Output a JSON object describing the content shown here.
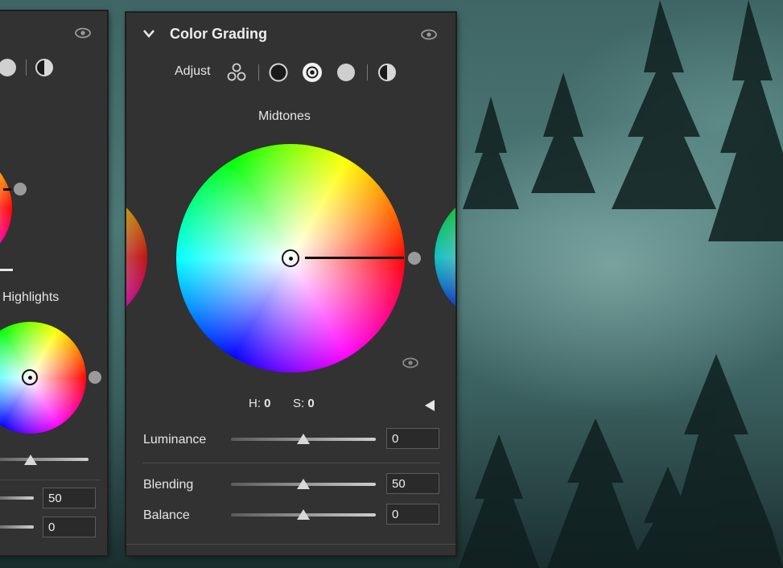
{
  "panel": {
    "title": "Color Grading",
    "adjust_label": "Adjust",
    "modes": [
      "three-way-icon",
      "shadows-mode-icon",
      "midtones-mode-icon",
      "highlights-mode-icon",
      "global-mode-icon"
    ],
    "selected_mode": "midtones"
  },
  "midtones": {
    "label": "Midtones",
    "h_label": "H:",
    "h_value": "0",
    "s_label": "S:",
    "s_value": "0"
  },
  "sliders": {
    "luminance": {
      "label": "Luminance",
      "value": "0",
      "position": 0.5
    },
    "blending": {
      "label": "Blending",
      "value": "50",
      "position": 0.5
    },
    "balance": {
      "label": "Balance",
      "value": "0",
      "position": 0.5
    }
  },
  "left_panel": {
    "highlights_label": "Highlights",
    "blending_value": "50",
    "balance_value": "0"
  }
}
